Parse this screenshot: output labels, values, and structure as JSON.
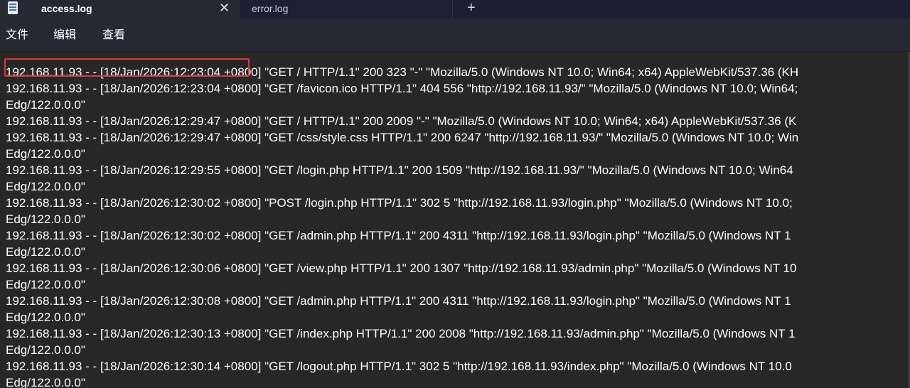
{
  "tabs": [
    {
      "label": "access.log",
      "active": true
    },
    {
      "label": "error.log",
      "active": false
    }
  ],
  "tab_close_icon": "✕",
  "new_tab_icon": "+",
  "menu": {
    "file": "文件",
    "edit": "编辑",
    "view": "查看"
  },
  "log_lines": [
    "192.168.11.93 - - [18/Jan/2026:12:23:04 +0800] \"GET / HTTP/1.1\" 200 323 \"-\" \"Mozilla/5.0 (Windows NT 10.0; Win64; x64) AppleWebKit/537.36 (KH",
    "192.168.11.93 - - [18/Jan/2026:12:23:04 +0800] \"GET /favicon.ico HTTP/1.1\" 404 556 \"http://192.168.11.93/\" \"Mozilla/5.0 (Windows NT 10.0; Win64;",
    "Edg/122.0.0.0\"",
    "192.168.11.93 - - [18/Jan/2026:12:29:47 +0800] \"GET / HTTP/1.1\" 200 2009 \"-\" \"Mozilla/5.0 (Windows NT 10.0; Win64; x64) AppleWebKit/537.36 (K",
    "192.168.11.93 - - [18/Jan/2026:12:29:47 +0800] \"GET /css/style.css HTTP/1.1\" 200 6247 \"http://192.168.11.93/\" \"Mozilla/5.0 (Windows NT 10.0; Win",
    "Edg/122.0.0.0\"",
    "192.168.11.93 - - [18/Jan/2026:12:29:55 +0800] \"GET /login.php HTTP/1.1\" 200 1509 \"http://192.168.11.93/\" \"Mozilla/5.0 (Windows NT 10.0; Win64",
    "Edg/122.0.0.0\"",
    "192.168.11.93 - - [18/Jan/2026:12:30:02 +0800] \"POST /login.php HTTP/1.1\" 302 5 \"http://192.168.11.93/login.php\" \"Mozilla/5.0 (Windows NT 10.0;",
    "Edg/122.0.0.0\"",
    "192.168.11.93 - - [18/Jan/2026:12:30:02 +0800] \"GET /admin.php HTTP/1.1\" 200 4311 \"http://192.168.11.93/login.php\" \"Mozilla/5.0 (Windows NT 1",
    "Edg/122.0.0.0\"",
    "192.168.11.93 - - [18/Jan/2026:12:30:06 +0800] \"GET /view.php HTTP/1.1\" 200 1307 \"http://192.168.11.93/admin.php\" \"Mozilla/5.0 (Windows NT 10",
    "Edg/122.0.0.0\"",
    "192.168.11.93 - - [18/Jan/2026:12:30:08 +0800] \"GET /admin.php HTTP/1.1\" 200 4311 \"http://192.168.11.93/login.php\" \"Mozilla/5.0 (Windows NT 1",
    "Edg/122.0.0.0\"",
    "192.168.11.93 - - [18/Jan/2026:12:30:13 +0800] \"GET /index.php HTTP/1.1\" 200 2008 \"http://192.168.11.93/admin.php\" \"Mozilla/5.0 (Windows NT 1",
    "Edg/122.0.0.0\"",
    "192.168.11.93 - - [18/Jan/2026:12:30:14 +0800] \"GET /logout.php HTTP/1.1\" 302 5 \"http://192.168.11.93/index.php\" \"Mozilla/5.0 (Windows NT 10.0",
    "Edg/122.0.0.0\""
  ],
  "colors": {
    "tabbar_bg": "#1c1d36",
    "active_tab_bg": "#262833",
    "content_bg": "#272727",
    "highlight": "#d63a3a",
    "text": "#ffffff"
  }
}
